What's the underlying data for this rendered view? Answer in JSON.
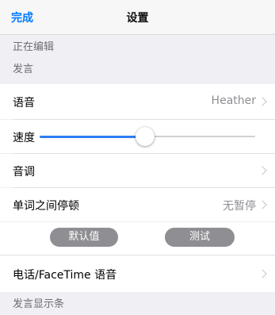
{
  "navbar": {
    "done_label": "完成",
    "title": "设置"
  },
  "sections": {
    "editing": "正在编辑",
    "speech": "发言",
    "speech_display": "发言显示条"
  },
  "rows": {
    "voice": {
      "label": "语音",
      "value": "Heather"
    },
    "speed": {
      "label": "速度",
      "level_fraction": 0.49
    },
    "pitch": {
      "label": "音调"
    },
    "pause": {
      "label": "单词之间停顿",
      "value": "无暂停"
    },
    "buttons": {
      "default_label": "默认值",
      "test_label": "测试"
    },
    "phone": {
      "label": "电话/FaceTime 语音"
    }
  },
  "colors": {
    "accent": "#007aff",
    "slider_fill": "#2f7df6",
    "button_gray": "#8e8e93"
  }
}
